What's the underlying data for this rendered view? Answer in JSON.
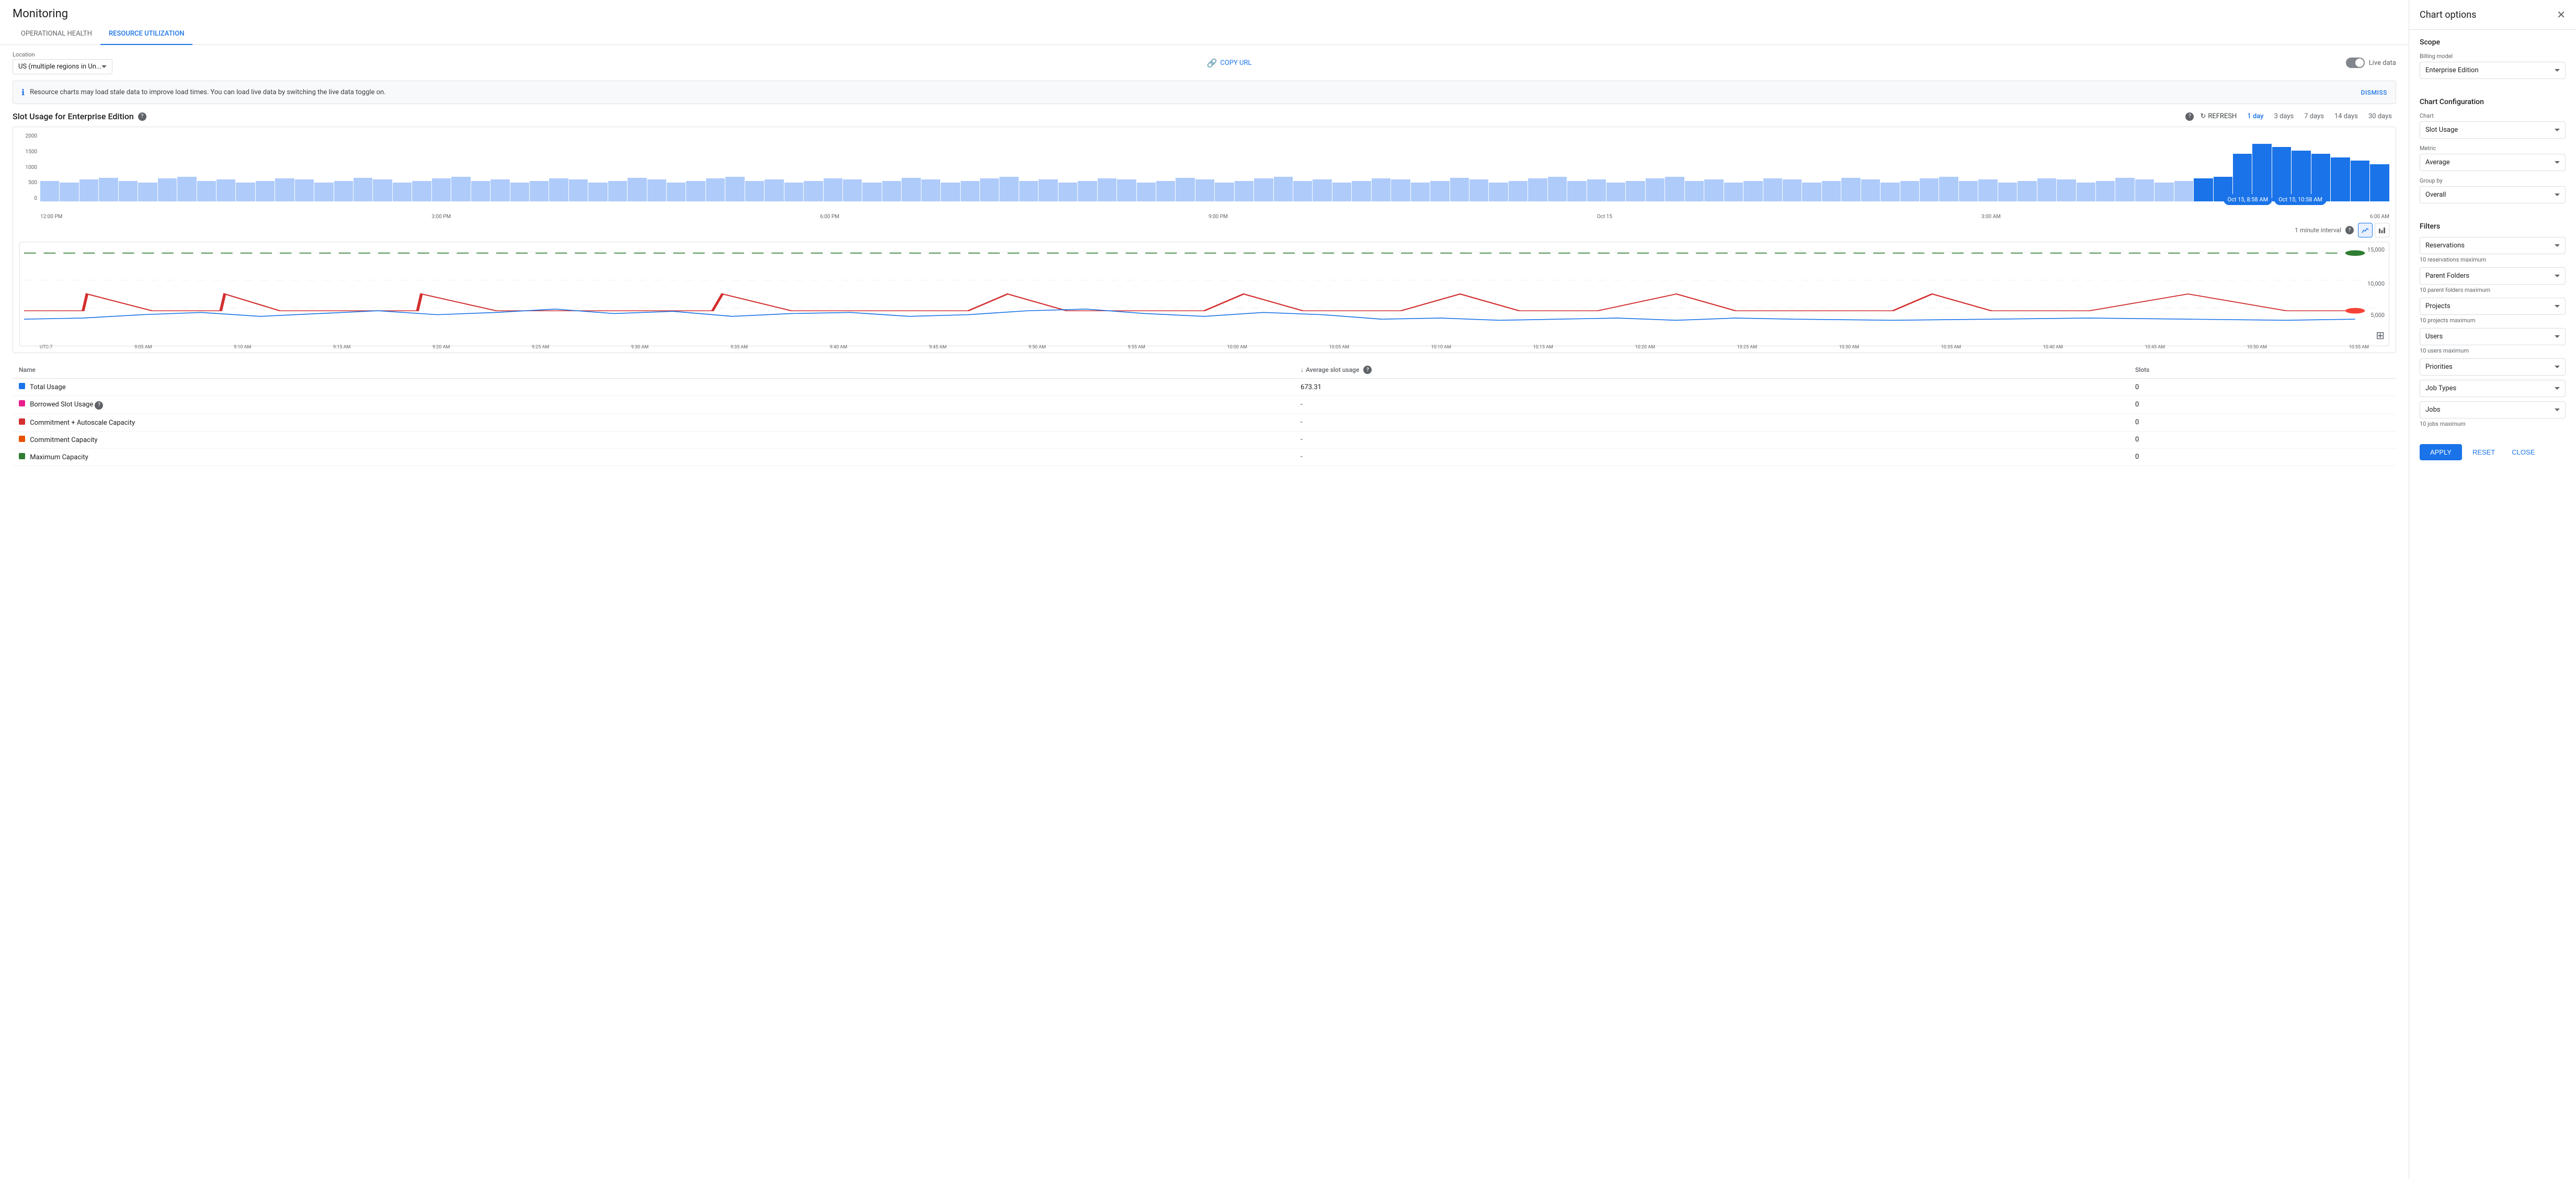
{
  "app": {
    "title": "Monitoring"
  },
  "tabs": [
    {
      "id": "operational",
      "label": "OPERATIONAL HEALTH",
      "active": false
    },
    {
      "id": "resource",
      "label": "RESOURCE UTILIZATION",
      "active": true
    }
  ],
  "toolbar": {
    "location_label": "Location",
    "location_value": "US (multiple regions in Un...",
    "copy_url_label": "COPY URL",
    "live_data_label": "Live data"
  },
  "info_banner": {
    "text": "Resource charts may load stale data to improve load times. You can load live data by switching the live data toggle on.",
    "dismiss_label": "DISMISS"
  },
  "chart": {
    "title": "Slot Usage for Enterprise Edition",
    "refresh_label": "REFRESH",
    "time_options": [
      "1 day",
      "3 days",
      "7 days",
      "14 days",
      "30 days"
    ],
    "active_time": "1 day",
    "y_axis": [
      "2000",
      "1500",
      "1000",
      "500",
      "0"
    ],
    "x_axis_labels": [
      "12:00 PM",
      "3:00 PM",
      "6:00 PM",
      "9:00 PM",
      "Oct 15",
      "3:00 AM",
      "6:00 AM"
    ],
    "selection_start": "Oct 15, 8:58 AM",
    "selection_end": "Oct 15, 10:58 AM",
    "interval_label": "1 minute interval"
  },
  "line_chart": {
    "y_axis_max": "15,000",
    "y_axis_mid": "10,000",
    "y_axis_5k": "5,000",
    "x_axis_labels": [
      "UTC-7",
      "9:05 AM",
      "9:10 AM",
      "9:15 AM",
      "9:20 AM",
      "9:25 AM",
      "9:30 AM",
      "9:35 AM",
      "9:40 AM",
      "9:45 AM",
      "9:50 AM",
      "9:55 AM",
      "10:00 AM",
      "10:05 AM",
      "10:10 AM",
      "10:15 AM",
      "10:20 AM",
      "10:25 AM",
      "10:30 AM",
      "10:35 AM",
      "10:40 AM",
      "10:45 AM",
      "10:50 AM",
      "10:55 AM"
    ]
  },
  "table": {
    "columns": [
      "Name",
      "Average slot usage",
      "Slots"
    ],
    "rows": [
      {
        "name": "Total Usage",
        "avg": "673.31",
        "slots": "0",
        "color": "#1a73e8",
        "shape": "square"
      },
      {
        "name": "Borrowed Slot Usage",
        "avg": "-",
        "slots": "0",
        "color": "#e91e8c",
        "shape": "square",
        "help": true
      },
      {
        "name": "Commitment + Autoscale Capacity",
        "avg": "-",
        "slots": "0",
        "color": "#d32f2f",
        "shape": "square"
      },
      {
        "name": "Commitment Capacity",
        "avg": "-",
        "slots": "0",
        "color": "#e65100",
        "shape": "square"
      },
      {
        "name": "Maximum Capacity",
        "avg": "-",
        "slots": "0",
        "color": "#2e7d32",
        "shape": "square"
      }
    ]
  },
  "panel": {
    "title": "Chart options",
    "scope_title": "Scope",
    "billing_model_label": "Billing model",
    "billing_model_value": "Enterprise Edition",
    "chart_config_title": "Chart Configuration",
    "chart_label": "Chart",
    "chart_value": "Slot Usage",
    "metric_label": "Metric",
    "metric_value": "Average",
    "group_by_label": "Group by",
    "group_by_value": "Overall",
    "filters_title": "Filters",
    "filters": [
      {
        "id": "reservations",
        "label": "Reservations",
        "sublabel": "10 reservations maximum"
      },
      {
        "id": "parent-folders",
        "label": "Parent Folders",
        "sublabel": "10 parent folders maximum"
      },
      {
        "id": "projects",
        "label": "Projects",
        "sublabel": "10 projects maximum"
      },
      {
        "id": "users",
        "label": "Users",
        "sublabel": "10 users maximum"
      },
      {
        "id": "priorities",
        "label": "Priorities",
        "sublabel": ""
      },
      {
        "id": "job-types",
        "label": "Job Types",
        "sublabel": ""
      },
      {
        "id": "jobs",
        "label": "Jobs",
        "sublabel": "10 jobs maximum"
      }
    ],
    "apply_label": "APPLY",
    "reset_label": "RESET",
    "close_label": "CLOSE"
  }
}
